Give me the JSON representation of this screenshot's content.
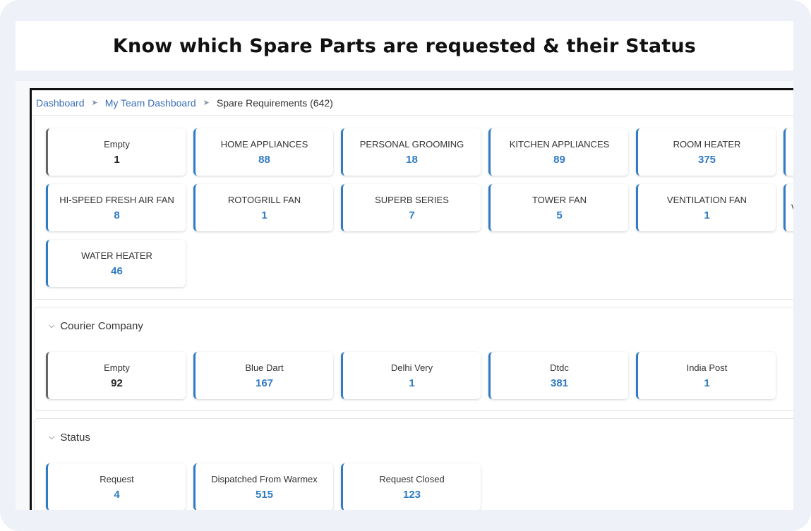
{
  "heading": "Know which Spare Parts are requested & their Status",
  "breadcrumb": {
    "items": [
      "Dashboard",
      "My Team Dashboard"
    ],
    "current": "Spare Requirements (642)",
    "separator": "➤"
  },
  "categories": [
    {
      "label": "Empty",
      "value": "1"
    },
    {
      "label": "HOME APPLIANCES",
      "value": "88"
    },
    {
      "label": "PERSONAL GROOMING",
      "value": "18"
    },
    {
      "label": "KITCHEN APPLIANCES",
      "value": "89"
    },
    {
      "label": "ROOM HEATER",
      "value": "375"
    },
    {
      "label": "HI-SPEED FRESH AIR FAN",
      "value": "8"
    },
    {
      "label": "ROTOGRILL FAN",
      "value": "1"
    },
    {
      "label": "SUPERB SERIES",
      "value": "7"
    },
    {
      "label": "TOWER FAN",
      "value": "5"
    },
    {
      "label": "VENTILATION FAN",
      "value": "1"
    },
    {
      "label": "WATER HEATER",
      "value": "46"
    }
  ],
  "partial_cards": [
    "",
    "V"
  ],
  "courier": {
    "title": "Courier Company",
    "items": [
      {
        "label": "Empty",
        "value": "92"
      },
      {
        "label": "Blue Dart",
        "value": "167"
      },
      {
        "label": "Delhi Very",
        "value": "1"
      },
      {
        "label": "Dtdc",
        "value": "381"
      },
      {
        "label": "India Post",
        "value": "1"
      }
    ]
  },
  "status": {
    "title": "Status",
    "items": [
      {
        "label": "Request",
        "value": "4"
      },
      {
        "label": "Dispatched From Warmex",
        "value": "515"
      },
      {
        "label": "Request Closed",
        "value": "123"
      }
    ]
  },
  "colors": {
    "accent": "#2f7bc4",
    "link": "#3b6fb8",
    "empty_border": "#666666"
  }
}
